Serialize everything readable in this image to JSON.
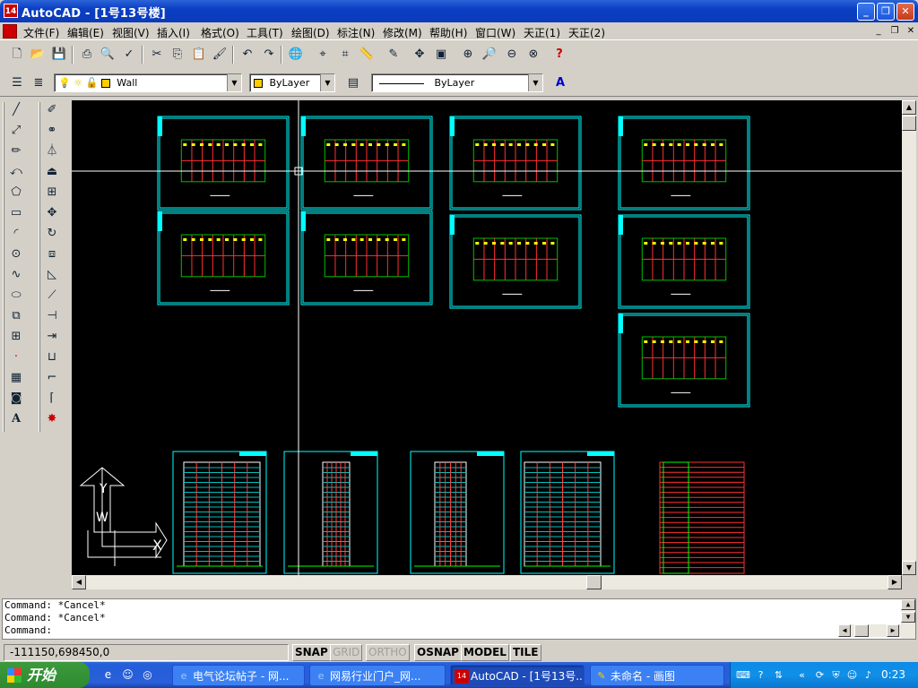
{
  "window": {
    "title": "AutoCAD - [1号13号楼]",
    "app_icon": "14",
    "controls": [
      "minimize-icon",
      "restore-icon",
      "close-icon"
    ]
  },
  "menu": {
    "items": [
      "文件(F)",
      "编辑(E)",
      "视图(V)",
      "插入(I)",
      "格式(O)",
      "工具(T)",
      "绘图(D)",
      "标注(N)",
      "修改(M)",
      "帮助(H)",
      "窗口(W)",
      "天正(1)",
      "天正(2)"
    ]
  },
  "toolbar_standard": {
    "icons": [
      "new-icon",
      "open-icon",
      "save-icon",
      "print-icon",
      "print-preview-icon",
      "spell-check-icon",
      "cut-icon",
      "copy-icon",
      "paste-icon",
      "match-properties-icon",
      "undo-icon",
      "redo-icon",
      "launch-browser-icon",
      "object-snap-icon",
      "ucs-icon",
      "distance-icon",
      "redraw-icon",
      "pan-icon",
      "aerial-view-icon",
      "zoom-window-icon",
      "zoom-realtime-icon",
      "zoom-previous-icon",
      "zoom-all-icon",
      "help-icon"
    ]
  },
  "toolbar_properties": {
    "layer_value": "Wall",
    "color_value": "ByLayer",
    "linetype_value": "ByLayer",
    "layer_color": "#ffcc00",
    "icons": [
      "layers-icon",
      "make-layer-current-icon",
      "layer-on-icon",
      "layer-freeze-icon",
      "layer-lock-icon",
      "layer-color-icon",
      "linetype-icon",
      "text-style-icon"
    ]
  },
  "draw_toolbar": {
    "icons": [
      "line-icon",
      "construction-line-icon",
      "polyline-icon",
      "rectangle-icon",
      "arc-icon",
      "circle-icon",
      "spline-icon",
      "ellipse-icon",
      "insert-block-icon",
      "make-block-icon",
      "point-icon",
      "hatch-icon",
      "region-icon",
      "multiline-text-icon",
      "polygon-icon",
      "revision-cloud-icon"
    ],
    "text_label": "A"
  },
  "modify_toolbar": {
    "icons": [
      "erase-icon",
      "copy-object-icon",
      "mirror-icon",
      "offset-icon",
      "array-icon",
      "move-icon",
      "rotate-icon",
      "scale-icon",
      "stretch-icon",
      "lengthen-icon",
      "trim-icon",
      "extend-icon",
      "break-icon",
      "chamfer-icon",
      "fillet-icon",
      "explode-icon"
    ]
  },
  "canvas": {
    "background": "#000000",
    "frame_color": "#00ffff",
    "crosshair_color": "#ffffff",
    "ucs_x_label": "X",
    "ucs_y_label": "Y",
    "ucs_w_label": "W"
  },
  "command_line": {
    "lines": [
      "Command: *Cancel*",
      "Command: *Cancel*",
      "Command:"
    ]
  },
  "status": {
    "coords": "-111150,698450,0",
    "toggles": [
      {
        "label": "SNAP",
        "on": true
      },
      {
        "label": "GRID",
        "on": false
      },
      {
        "label": "ORTHO",
        "on": false
      },
      {
        "label": "OSNAP",
        "on": true
      },
      {
        "label": "MODEL",
        "on": true
      },
      {
        "label": "TILE",
        "on": true
      }
    ]
  },
  "taskbar": {
    "start_label": "开始",
    "tasks": [
      {
        "label": "电气论坛帖子 - 网...",
        "icon": "ie-icon"
      },
      {
        "label": "网易行业门户_网...",
        "icon": "ie-icon"
      },
      {
        "label": "AutoCAD - [1号13号...",
        "icon": "autocad-icon"
      },
      {
        "label": "未命名 - 画图",
        "icon": "paint-icon"
      }
    ],
    "clock": "0:23"
  }
}
